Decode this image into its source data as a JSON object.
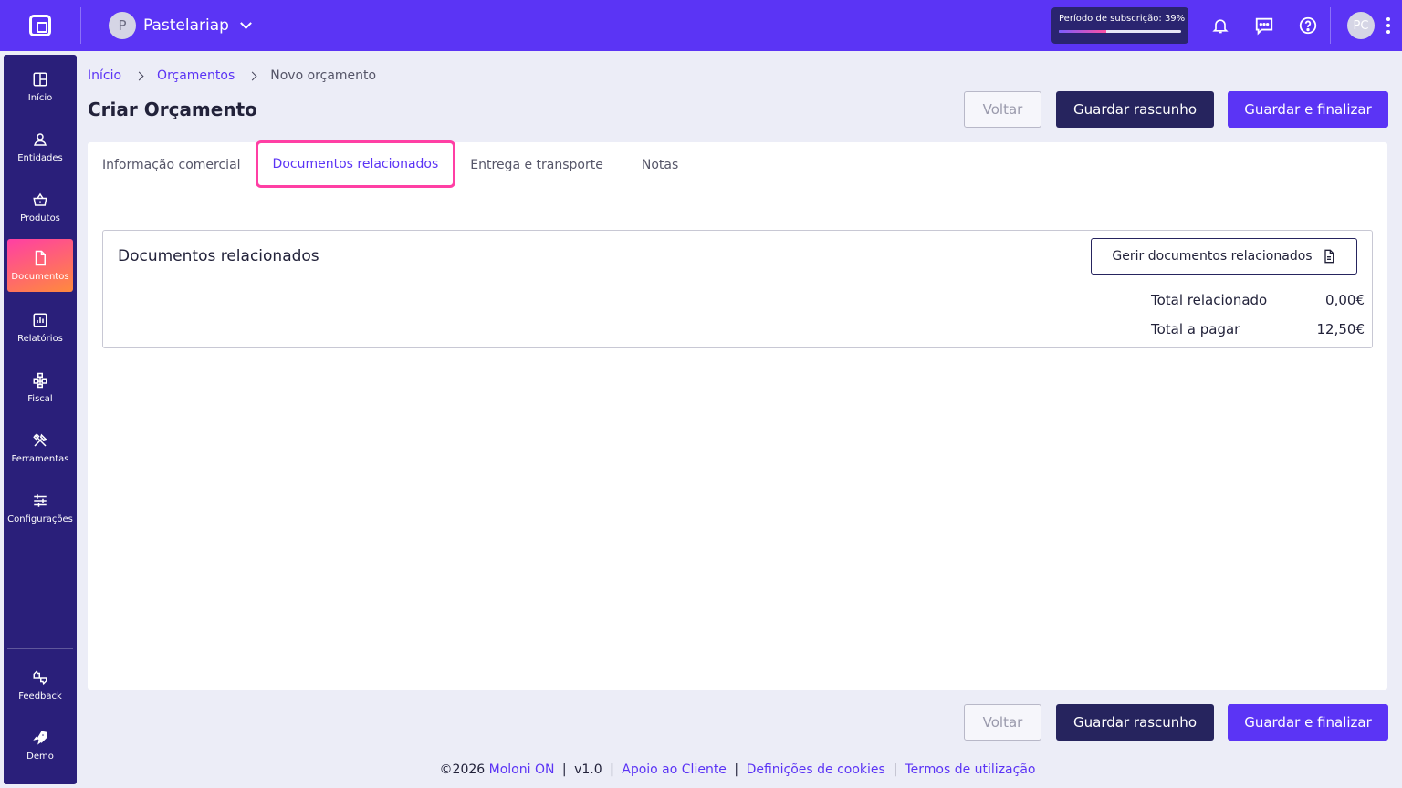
{
  "colors": {
    "brand": "#5b34f5",
    "sidebar": "#2a1f7a",
    "primary_dark": "#26245e",
    "highlight": "#ff3fa4"
  },
  "topbar": {
    "company_initial": "P",
    "company_name": "Pastelariap",
    "subscription_label": "Período de subscrição: 39%",
    "subscription_progress": 0.39,
    "user_initials": "PC",
    "icons": [
      "moloni-logo-icon",
      "bell-icon",
      "chat-icon",
      "help-icon",
      "kebab-menu-icon"
    ]
  },
  "sidebar": {
    "items": [
      {
        "label": "Início",
        "icon": "grid-icon"
      },
      {
        "label": "Entidades",
        "icon": "user-icon"
      },
      {
        "label": "Produtos",
        "icon": "basket-icon"
      },
      {
        "label": "Documentos",
        "icon": "document-icon",
        "active": true
      },
      {
        "label": "Relatórios",
        "icon": "chart-icon"
      },
      {
        "label": "Fiscal",
        "icon": "hierarchy-icon"
      },
      {
        "label": "Ferramentas",
        "icon": "tools-icon"
      },
      {
        "label": "Configurações",
        "icon": "sliders-icon"
      },
      {
        "label": "Feedback",
        "icon": "feedback-icon"
      },
      {
        "label": "Demo",
        "icon": "rocket-icon"
      }
    ]
  },
  "breadcrumb": {
    "home": "Início",
    "section": "Orçamentos",
    "current": "Novo orçamento"
  },
  "page": {
    "title": "Criar Orçamento"
  },
  "actions": {
    "back": "Voltar",
    "draft": "Guardar rascunho",
    "finalize": "Guardar e finalizar"
  },
  "tabs": [
    {
      "label": "Informação comercial"
    },
    {
      "label": "Documentos relacionados",
      "active": true
    },
    {
      "label": "Entrega e transporte"
    },
    {
      "label": "Notas"
    }
  ],
  "related": {
    "title": "Documentos relacionados",
    "manage_button": "Gerir documentos relacionados",
    "total_related_label": "Total relacionado",
    "total_related_value": "0,00€",
    "total_to_pay_label": "Total a pagar",
    "total_to_pay_value": "12,50€"
  },
  "footer": {
    "copyright": "©2026",
    "brand_link": "Moloni ON",
    "version": "v1.0",
    "support": "Apoio ao Cliente",
    "cookies": "Definições de cookies",
    "terms": "Termos de utilização"
  }
}
